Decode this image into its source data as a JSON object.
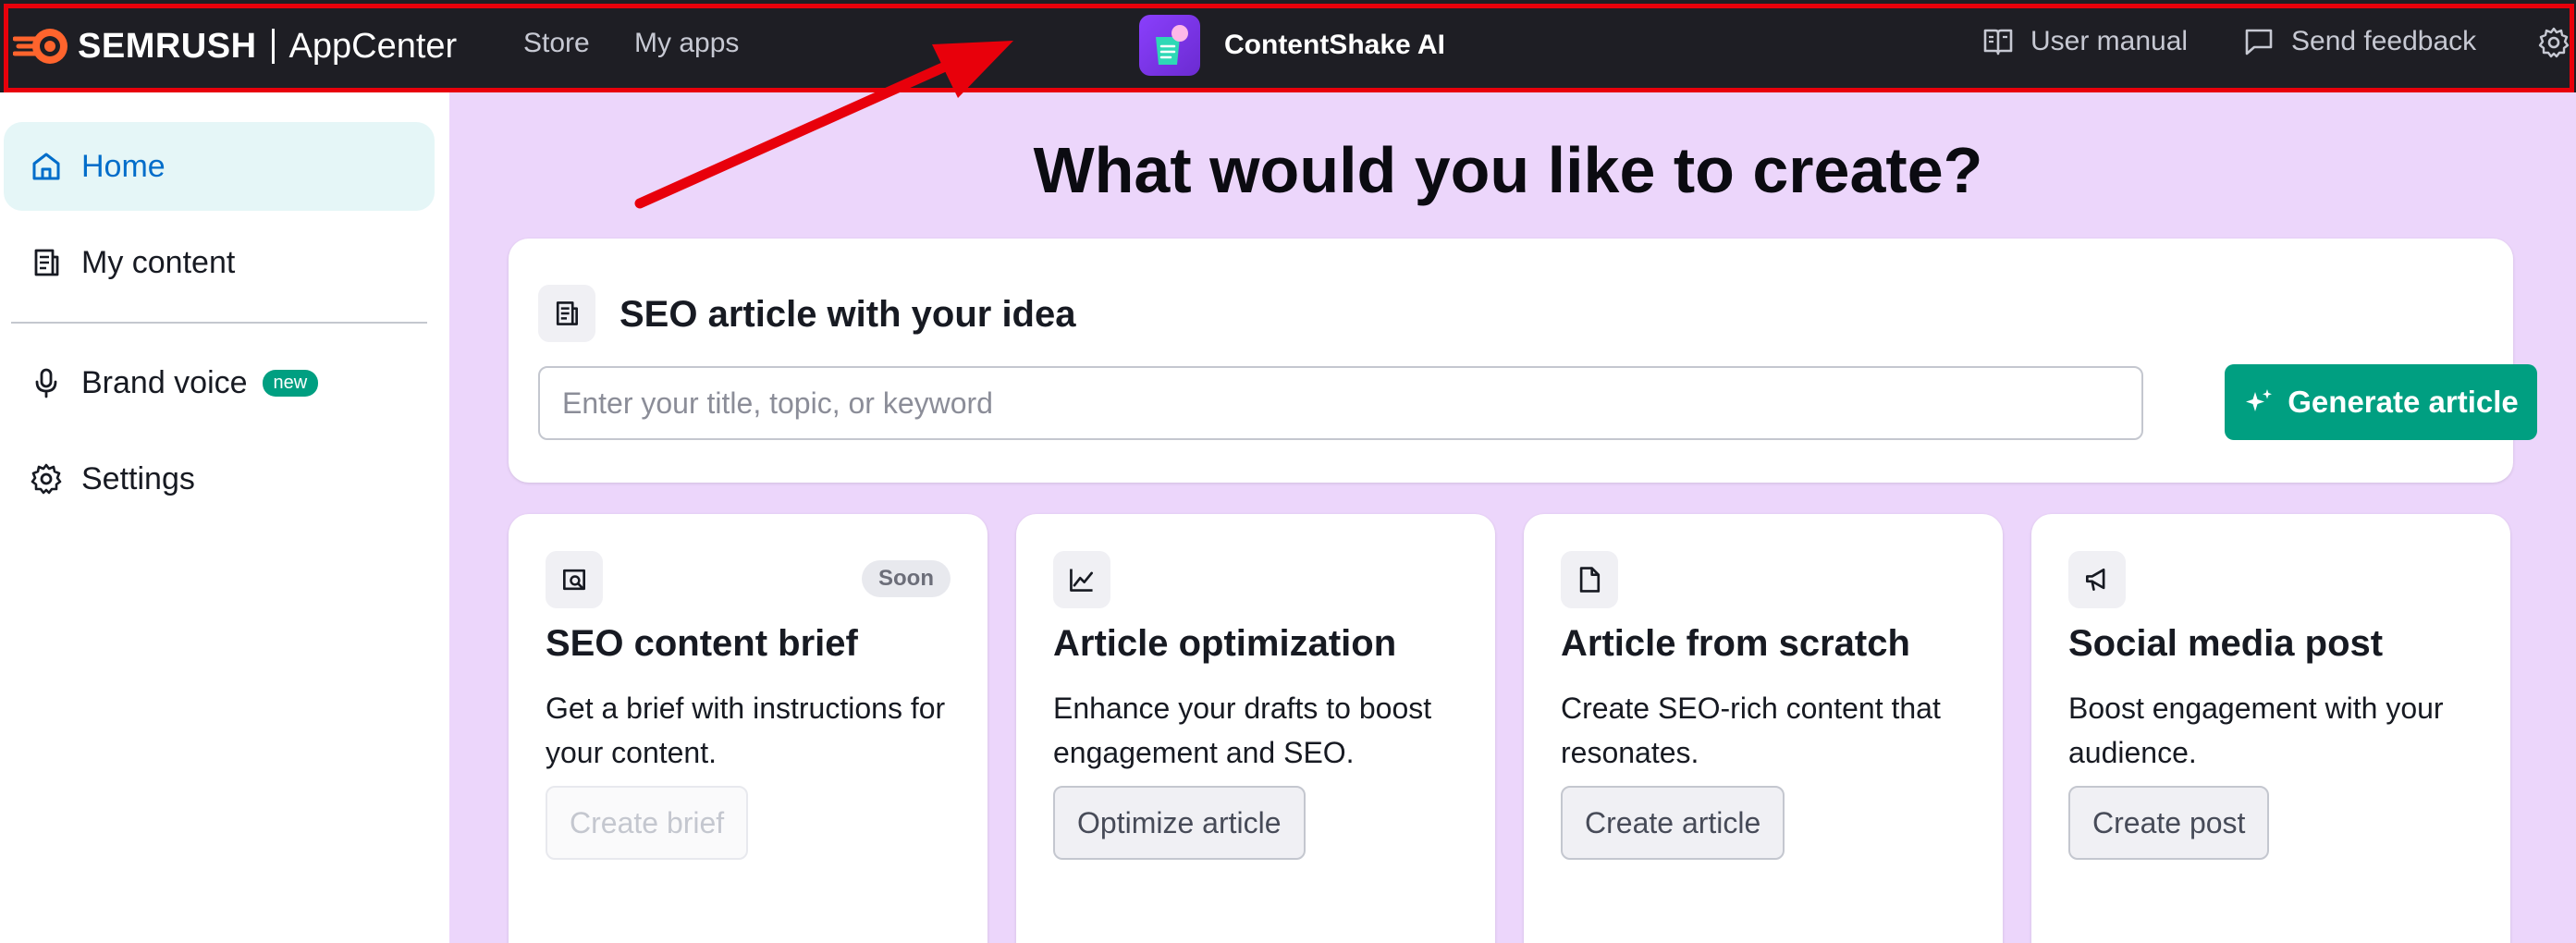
{
  "topbar": {
    "brand": "SEMRUSH",
    "product": "AppCenter",
    "nav": [
      {
        "label": "Store"
      },
      {
        "label": "My apps"
      }
    ],
    "app_name": "ContentShake AI",
    "actions": [
      {
        "label": "User manual",
        "icon": "book-icon"
      },
      {
        "label": "Send feedback",
        "icon": "feedback-icon"
      }
    ],
    "settings_icon": "gear-icon"
  },
  "sidebar": {
    "items": [
      {
        "label": "Home",
        "icon": "home-icon",
        "active": true
      },
      {
        "label": "My content",
        "icon": "document-icon"
      },
      {
        "label": "Brand voice",
        "icon": "microphone-icon",
        "badge": "new"
      },
      {
        "label": "Settings",
        "icon": "gear-icon"
      }
    ]
  },
  "main": {
    "heading": "What would you like to create?",
    "seo": {
      "title": "SEO article with your idea",
      "placeholder": "Enter your title, topic, or keyword",
      "value": "",
      "button": "Generate article"
    },
    "tiles": [
      {
        "title": "SEO content brief",
        "desc": "Get a brief with instructions for your content.",
        "button": "Create brief",
        "badge": "Soon",
        "disabled": true,
        "icon": "search-document-icon"
      },
      {
        "title": "Article optimization",
        "desc": "Enhance your drafts to boost engagement and SEO.",
        "button": "Optimize article",
        "icon": "chart-icon"
      },
      {
        "title": "Article from scratch",
        "desc": "Create SEO-rich content that resonates.",
        "button": "Create article",
        "icon": "page-icon"
      },
      {
        "title": "Social media post",
        "desc": "Boost engagement with your audience.",
        "button": "Create post",
        "icon": "megaphone-icon"
      }
    ]
  },
  "colors": {
    "topbar": "#1e1e24",
    "accent": "#009f81",
    "main_bg": "#ecd6fb",
    "annotation": "#e8000b"
  }
}
